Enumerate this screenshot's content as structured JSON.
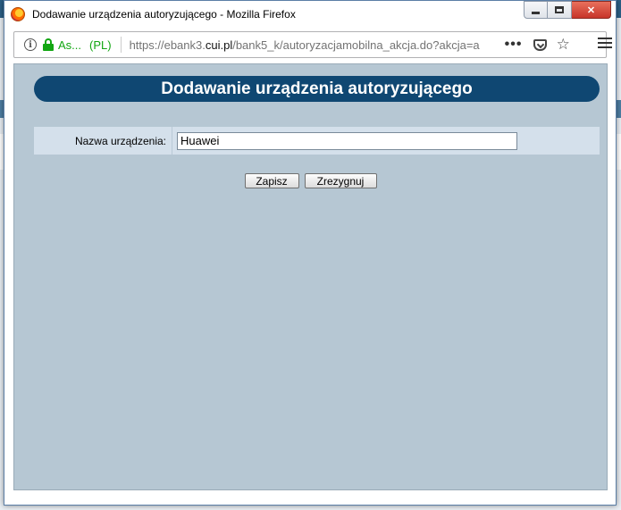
{
  "window": {
    "title": "Dodawanie urządzenia autoryzującego - Mozilla Firefox"
  },
  "address_bar": {
    "site_identity": "As...",
    "site_country": "(PL)",
    "url_prefix": "https://ebank3.",
    "url_domain": "cui.pl",
    "url_rest": "/bank5_k/autoryzacjamobilna_akcja.do?akcja=a",
    "more_glyph": "•••",
    "star_glyph": "☆"
  },
  "page": {
    "heading": "Dodawanie urządzenia autoryzującego",
    "device_name_label": "Nazwa urządzenia:",
    "device_name_value": "Huawei",
    "save_label": "Zapisz",
    "cancel_label": "Zrezygnuj"
  },
  "colors": {
    "header_bg": "#0f4772",
    "content_bg": "#b6c7d3",
    "row_bg": "#d4e0eb",
    "secure_green": "#12a612"
  }
}
